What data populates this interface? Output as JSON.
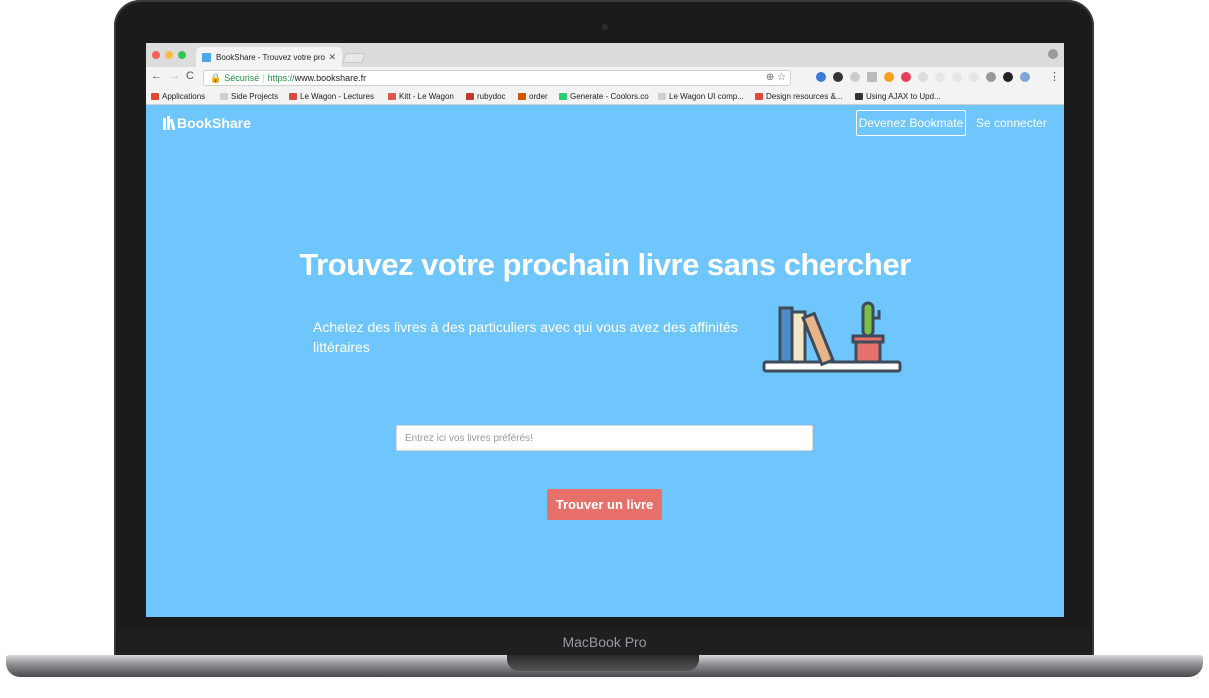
{
  "device": {
    "label": "MacBook Pro"
  },
  "browser": {
    "tab_title": "BookShare - Trouvez votre pro",
    "url_secure_label": "Sécurisé",
    "url_protocol": "https://",
    "url_host": "www.bookshare.fr",
    "bookmarks": [
      {
        "label": "Applications",
        "color": "#e04a2f"
      },
      {
        "label": "Side Projects",
        "color": "#cfcfcf"
      },
      {
        "label": "Le Wagon - Lectures",
        "color": "#d94b3d"
      },
      {
        "label": "Kitt - Le Wagon",
        "color": "#e0564a"
      },
      {
        "label": "rubydoc",
        "color": "#c0392b"
      },
      {
        "label": "order",
        "color": "#d35400"
      },
      {
        "label": "Generate - Coolors.co",
        "color": "#2ecc71"
      },
      {
        "label": "Le Wagon UI comp...",
        "color": "#cfcfcf"
      },
      {
        "label": "Design resources &...",
        "color": "#d94b3d"
      },
      {
        "label": "Using AJAX to Upd...",
        "color": "#333333"
      }
    ]
  },
  "navbar": {
    "brand": "BookShare",
    "signup_label": "Devenez Bookmate",
    "login_label": "Se connecter"
  },
  "hero": {
    "title": "Trouvez votre prochain livre sans chercher",
    "subtitle": "Achetez des livres à des particuliers avec qui vous avez des affinités littéraires"
  },
  "search": {
    "placeholder": "Entrez ici vos livres préférés!"
  },
  "cta": {
    "label": "Trouver un livre"
  },
  "colors": {
    "page_bg": "#6ec6fc",
    "cta": "#e8706a",
    "text": "#ffffff"
  }
}
